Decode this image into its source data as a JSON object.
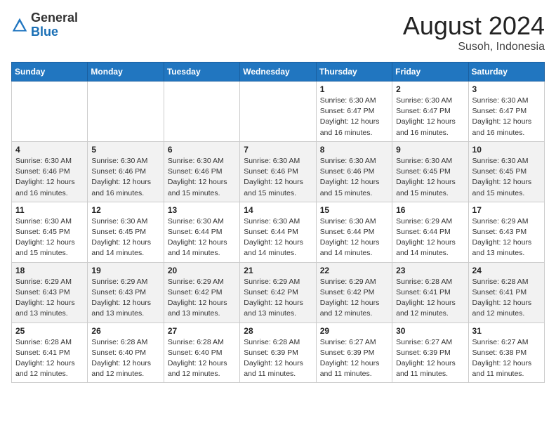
{
  "header": {
    "logo_general": "General",
    "logo_blue": "Blue",
    "month_year": "August 2024",
    "location": "Susoh, Indonesia"
  },
  "weekdays": [
    "Sunday",
    "Monday",
    "Tuesday",
    "Wednesday",
    "Thursday",
    "Friday",
    "Saturday"
  ],
  "weeks": [
    [
      {
        "day": "",
        "info": ""
      },
      {
        "day": "",
        "info": ""
      },
      {
        "day": "",
        "info": ""
      },
      {
        "day": "",
        "info": ""
      },
      {
        "day": "1",
        "info": "Sunrise: 6:30 AM\nSunset: 6:47 PM\nDaylight: 12 hours\nand 16 minutes."
      },
      {
        "day": "2",
        "info": "Sunrise: 6:30 AM\nSunset: 6:47 PM\nDaylight: 12 hours\nand 16 minutes."
      },
      {
        "day": "3",
        "info": "Sunrise: 6:30 AM\nSunset: 6:47 PM\nDaylight: 12 hours\nand 16 minutes."
      }
    ],
    [
      {
        "day": "4",
        "info": "Sunrise: 6:30 AM\nSunset: 6:46 PM\nDaylight: 12 hours\nand 16 minutes."
      },
      {
        "day": "5",
        "info": "Sunrise: 6:30 AM\nSunset: 6:46 PM\nDaylight: 12 hours\nand 16 minutes."
      },
      {
        "day": "6",
        "info": "Sunrise: 6:30 AM\nSunset: 6:46 PM\nDaylight: 12 hours\nand 15 minutes."
      },
      {
        "day": "7",
        "info": "Sunrise: 6:30 AM\nSunset: 6:46 PM\nDaylight: 12 hours\nand 15 minutes."
      },
      {
        "day": "8",
        "info": "Sunrise: 6:30 AM\nSunset: 6:46 PM\nDaylight: 12 hours\nand 15 minutes."
      },
      {
        "day": "9",
        "info": "Sunrise: 6:30 AM\nSunset: 6:45 PM\nDaylight: 12 hours\nand 15 minutes."
      },
      {
        "day": "10",
        "info": "Sunrise: 6:30 AM\nSunset: 6:45 PM\nDaylight: 12 hours\nand 15 minutes."
      }
    ],
    [
      {
        "day": "11",
        "info": "Sunrise: 6:30 AM\nSunset: 6:45 PM\nDaylight: 12 hours\nand 15 minutes."
      },
      {
        "day": "12",
        "info": "Sunrise: 6:30 AM\nSunset: 6:45 PM\nDaylight: 12 hours\nand 14 minutes."
      },
      {
        "day": "13",
        "info": "Sunrise: 6:30 AM\nSunset: 6:44 PM\nDaylight: 12 hours\nand 14 minutes."
      },
      {
        "day": "14",
        "info": "Sunrise: 6:30 AM\nSunset: 6:44 PM\nDaylight: 12 hours\nand 14 minutes."
      },
      {
        "day": "15",
        "info": "Sunrise: 6:30 AM\nSunset: 6:44 PM\nDaylight: 12 hours\nand 14 minutes."
      },
      {
        "day": "16",
        "info": "Sunrise: 6:29 AM\nSunset: 6:44 PM\nDaylight: 12 hours\nand 14 minutes."
      },
      {
        "day": "17",
        "info": "Sunrise: 6:29 AM\nSunset: 6:43 PM\nDaylight: 12 hours\nand 13 minutes."
      }
    ],
    [
      {
        "day": "18",
        "info": "Sunrise: 6:29 AM\nSunset: 6:43 PM\nDaylight: 12 hours\nand 13 minutes."
      },
      {
        "day": "19",
        "info": "Sunrise: 6:29 AM\nSunset: 6:43 PM\nDaylight: 12 hours\nand 13 minutes."
      },
      {
        "day": "20",
        "info": "Sunrise: 6:29 AM\nSunset: 6:42 PM\nDaylight: 12 hours\nand 13 minutes."
      },
      {
        "day": "21",
        "info": "Sunrise: 6:29 AM\nSunset: 6:42 PM\nDaylight: 12 hours\nand 13 minutes."
      },
      {
        "day": "22",
        "info": "Sunrise: 6:29 AM\nSunset: 6:42 PM\nDaylight: 12 hours\nand 12 minutes."
      },
      {
        "day": "23",
        "info": "Sunrise: 6:28 AM\nSunset: 6:41 PM\nDaylight: 12 hours\nand 12 minutes."
      },
      {
        "day": "24",
        "info": "Sunrise: 6:28 AM\nSunset: 6:41 PM\nDaylight: 12 hours\nand 12 minutes."
      }
    ],
    [
      {
        "day": "25",
        "info": "Sunrise: 6:28 AM\nSunset: 6:41 PM\nDaylight: 12 hours\nand 12 minutes."
      },
      {
        "day": "26",
        "info": "Sunrise: 6:28 AM\nSunset: 6:40 PM\nDaylight: 12 hours\nand 12 minutes."
      },
      {
        "day": "27",
        "info": "Sunrise: 6:28 AM\nSunset: 6:40 PM\nDaylight: 12 hours\nand 12 minutes."
      },
      {
        "day": "28",
        "info": "Sunrise: 6:28 AM\nSunset: 6:39 PM\nDaylight: 12 hours\nand 11 minutes."
      },
      {
        "day": "29",
        "info": "Sunrise: 6:27 AM\nSunset: 6:39 PM\nDaylight: 12 hours\nand 11 minutes."
      },
      {
        "day": "30",
        "info": "Sunrise: 6:27 AM\nSunset: 6:39 PM\nDaylight: 12 hours\nand 11 minutes."
      },
      {
        "day": "31",
        "info": "Sunrise: 6:27 AM\nSunset: 6:38 PM\nDaylight: 12 hours\nand 11 minutes."
      }
    ]
  ]
}
